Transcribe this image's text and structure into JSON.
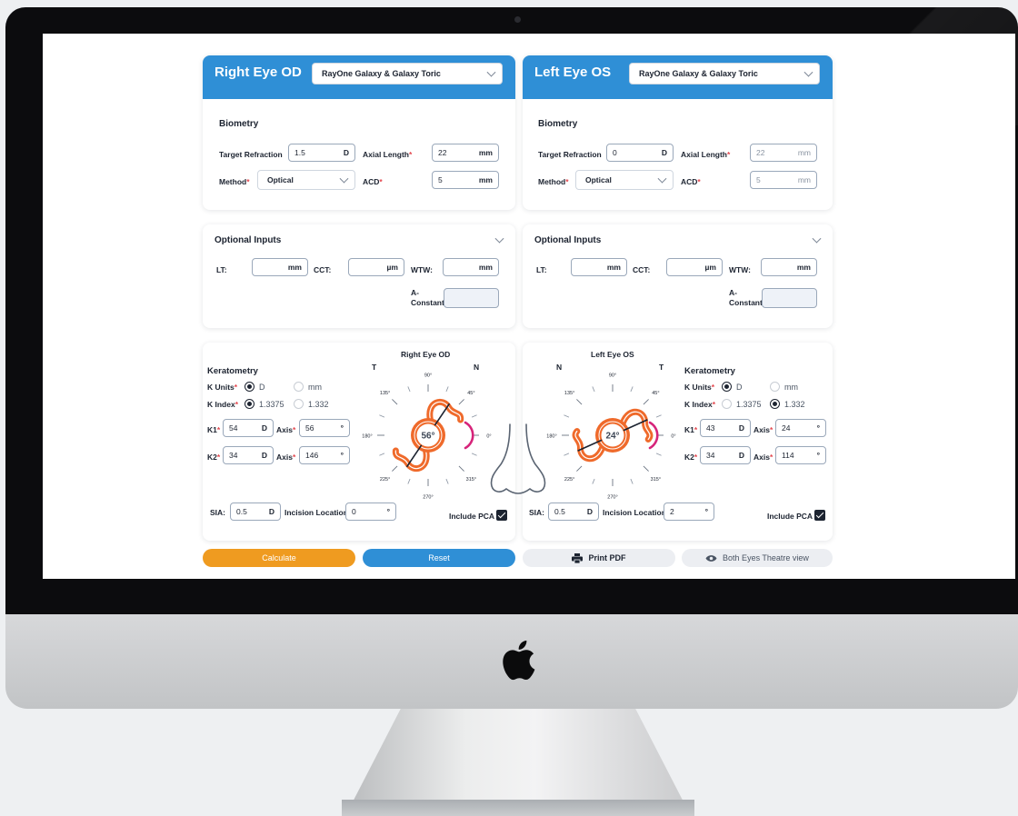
{
  "right_eye": {
    "title": "Right Eye OD",
    "lens": "RayOne Galaxy & Galaxy Toric",
    "biometry": {
      "section": "Biometry",
      "target_refraction_label": "Target Refraction",
      "target_refraction_value": "1.5",
      "target_refraction_unit": "D",
      "axial_length_label": "Axial Length",
      "axial_length_value": "22",
      "axial_length_unit": "mm",
      "method_label": "Method",
      "method_value": "Optical",
      "acd_label": "ACD",
      "acd_value": "5",
      "acd_unit": "mm"
    },
    "optional": {
      "section": "Optional Inputs",
      "lt_label": "LT:",
      "lt_unit": "mm",
      "cct_label": "CCT:",
      "cct_unit": "µm",
      "wtw_label": "WTW:",
      "wtw_unit": "mm",
      "a_constant_label_1": "A-",
      "a_constant_label_2": "Constant"
    },
    "keratometry": {
      "diagram_title": "Right Eye OD",
      "left_letter": "T",
      "right_letter": "N",
      "section": "Keratometry",
      "k_units_label": "K Units",
      "k_units_options": [
        "D",
        "mm"
      ],
      "k_units_selected": "D",
      "k_index_label": "K Index",
      "k_index_options": [
        "1.3375",
        "1.332"
      ],
      "k_index_selected": "1.3375",
      "k1_label": "K1",
      "k1_value": "54",
      "k1_unit": "D",
      "k1_axis_label": "Axis",
      "k1_axis_value": "56",
      "k1_axis_unit": "°",
      "k2_label": "K2",
      "k2_value": "34",
      "k2_unit": "D",
      "k2_axis_label": "Axis",
      "k2_axis_value": "146",
      "k2_axis_unit": "°",
      "axis_display": "56°",
      "axis_deg": 56,
      "sia_label": "SIA:",
      "sia_value": "0.5",
      "sia_unit": "D",
      "incision_label": "Incision Location",
      "incision_value": "0",
      "incision_unit": "°",
      "include_pca_label": "Include PCA",
      "include_pca": true
    }
  },
  "left_eye": {
    "title": "Left Eye OS",
    "lens": "RayOne Galaxy & Galaxy Toric",
    "biometry": {
      "section": "Biometry",
      "target_refraction_label": "Target Refraction",
      "target_refraction_value": "0",
      "target_refraction_unit": "D",
      "axial_length_label": "Axial Length",
      "axial_length_value": "22",
      "axial_length_unit": "mm",
      "method_label": "Method",
      "method_value": "Optical",
      "acd_label": "ACD",
      "acd_value": "5",
      "acd_unit": "mm"
    },
    "optional": {
      "section": "Optional Inputs",
      "lt_label": "LT:",
      "lt_unit": "mm",
      "cct_label": "CCT:",
      "cct_unit": "µm",
      "wtw_label": "WTW:",
      "wtw_unit": "mm",
      "a_constant_label_1": "A-",
      "a_constant_label_2": "Constant"
    },
    "keratometry": {
      "diagram_title": "Left Eye OS",
      "left_letter": "N",
      "right_letter": "T",
      "section": "Keratometry",
      "k_units_label": "K Units",
      "k_units_options": [
        "D",
        "mm"
      ],
      "k_units_selected": "D",
      "k_index_label": "K Index",
      "k_index_options": [
        "1.3375",
        "1.332"
      ],
      "k_index_selected": "1.332",
      "k1_label": "K1",
      "k1_value": "43",
      "k1_unit": "D",
      "k1_axis_label": "Axis",
      "k1_axis_value": "24",
      "k1_axis_unit": "°",
      "k2_label": "K2",
      "k2_value": "34",
      "k2_unit": "D",
      "k2_axis_label": "Axis",
      "k2_axis_value": "114",
      "k2_axis_unit": "°",
      "axis_display": "24°",
      "axis_deg": 24,
      "sia_label": "SIA:",
      "sia_value": "0.5",
      "sia_unit": "D",
      "incision_label": "Incision Location",
      "incision_value": "2",
      "incision_unit": "°",
      "include_pca_label": "Include PCA",
      "include_pca": true
    }
  },
  "dial_ticks": [
    "90°",
    "45°",
    "0°",
    "315°",
    "270°",
    "225°",
    "180°",
    "135°"
  ],
  "buttons": {
    "calculate": "Calculate",
    "reset": "Reset",
    "print_pdf": "Print PDF",
    "theatre_view": "Both Eyes Theatre view"
  },
  "colors": {
    "header_blue": "#2f8fd6",
    "calculate_orange": "#ef9b20",
    "lens_orange": "#ef6a2b",
    "incision_magenta": "#d6247a",
    "required_red": "#e4474e"
  },
  "icons": {
    "print": "printer-icon",
    "theatre": "eye-icon",
    "brand": "apple-logo"
  }
}
